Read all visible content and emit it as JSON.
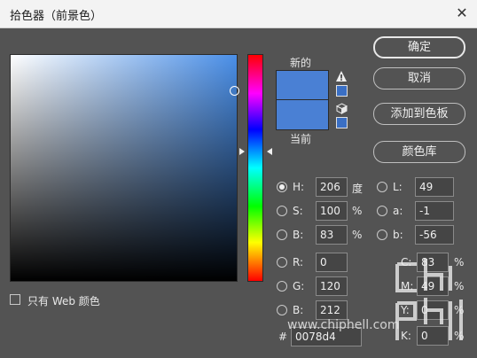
{
  "window": {
    "title": "拾色器（前景色）",
    "close_glyph": "✕"
  },
  "swatches": {
    "new_label": "新的",
    "current_label": "当前"
  },
  "buttons": {
    "ok": "确定",
    "cancel": "取消",
    "add_to_swatches": "添加到色板",
    "color_libraries": "颜色库"
  },
  "hsb": {
    "h": {
      "label": "H:",
      "value": "206",
      "unit": "度"
    },
    "s": {
      "label": "S:",
      "value": "100",
      "unit": "%"
    },
    "b": {
      "label": "B:",
      "value": "83",
      "unit": "%"
    }
  },
  "lab": {
    "l": {
      "label": "L:",
      "value": "49"
    },
    "a": {
      "label": "a:",
      "value": "-1"
    },
    "b": {
      "label": "b:",
      "value": "-56"
    }
  },
  "rgb": {
    "r": {
      "label": "R:",
      "value": "0"
    },
    "g": {
      "label": "G:",
      "value": "120"
    },
    "b": {
      "label": "B:",
      "value": "212"
    }
  },
  "cmyk": {
    "c": {
      "label": "C:",
      "value": "83",
      "unit": "%"
    },
    "m": {
      "label": "M:",
      "value": "49",
      "unit": "%"
    },
    "y": {
      "label": "Y:",
      "value": "0",
      "unit": "%"
    },
    "k": {
      "label": "K:",
      "value": "0",
      "unit": "%"
    }
  },
  "hex": {
    "label": "#",
    "value": "0078d4"
  },
  "web_only": {
    "label": "只有 Web 颜色"
  },
  "watermark": {
    "text": "www.chiphell.com"
  },
  "colors": {
    "selected": "#4a80d4",
    "background": "#535353"
  }
}
